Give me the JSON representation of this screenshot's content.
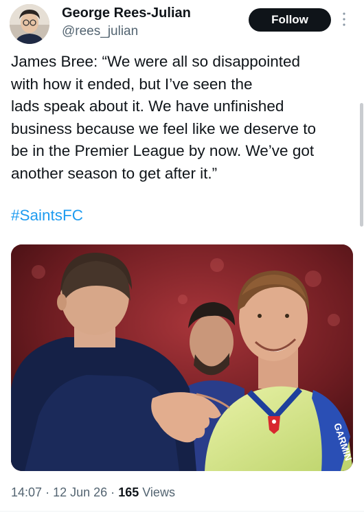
{
  "author": {
    "display_name": "George Rees-Julian",
    "handle": "@rees_julian",
    "follow_label": "Follow",
    "avatar_icon": "user-avatar-photo"
  },
  "tweet": {
    "lines": [
      "James Bree: “We were all so disappointed",
      "with how it ended, but I’ve seen the",
      "lads speak about it. We have unfinished",
      "business because we feel like we deserve to",
      "be in the Premier League by now. We’ve got",
      "another season to get after it.”"
    ],
    "hashtag": "#SaintsFC",
    "media_kit_sponsor": "GARMIN"
  },
  "meta": {
    "time": "14:07",
    "separator": "·",
    "date": "12 Jun 26",
    "views_count": "165",
    "views_label": "Views"
  },
  "colors": {
    "text": "#0f1419",
    "secondary": "#536471",
    "link": "#1d9bf0",
    "follow_bg": "#0f1419"
  }
}
